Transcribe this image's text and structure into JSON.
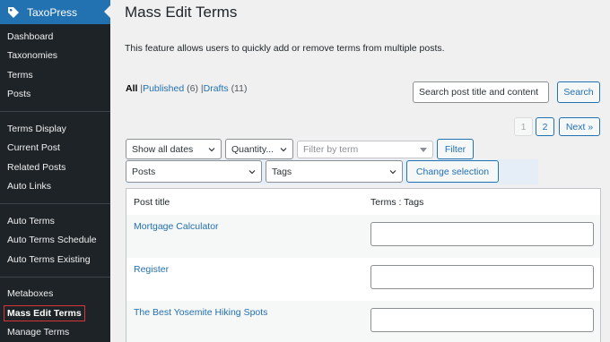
{
  "sidebar": {
    "brand": "TaxoPress",
    "group1": [
      "Dashboard",
      "Taxonomies",
      "Terms",
      "Posts"
    ],
    "group2": [
      "Terms Display",
      "Current Post",
      "Related Posts",
      "Auto Links"
    ],
    "group3": [
      "Auto Terms",
      "Auto Terms Schedule",
      "Auto Terms Existing"
    ],
    "group4": [
      "Metaboxes",
      "Mass Edit Terms",
      "Manage Terms"
    ]
  },
  "header": {
    "title": "Mass Edit Terms",
    "description": "This feature allows users to quickly add or remove terms from multiple posts."
  },
  "views": {
    "all": "All",
    "published": "Published",
    "published_count": "(6)",
    "drafts": "Drafts",
    "drafts_count": "(11)",
    "sep": "|"
  },
  "search": {
    "placeholder": "Search post title and content",
    "button": "Search"
  },
  "pagination": {
    "current": "1",
    "next_page": "2",
    "next": "Next »"
  },
  "filters": {
    "dates": "Show all dates",
    "quantity": "Quantity...",
    "term_placeholder": "Filter by term",
    "filter_button": "Filter"
  },
  "selection": {
    "post_type": "Posts",
    "taxonomy": "Tags",
    "change_button": "Change selection"
  },
  "table": {
    "col_title": "Post title",
    "col_terms": "Terms : Tags",
    "rows": [
      {
        "title": "Mortgage Calculator",
        "terms": ""
      },
      {
        "title": "Register",
        "terms": ""
      },
      {
        "title": "The Best Yosemite Hiking Spots",
        "terms": ""
      }
    ]
  },
  "colors": {
    "accent": "#2271b1",
    "sidebar_bg": "#1d2327",
    "page_bg": "#f0f0f1",
    "highlight_outline": "#d63638"
  }
}
